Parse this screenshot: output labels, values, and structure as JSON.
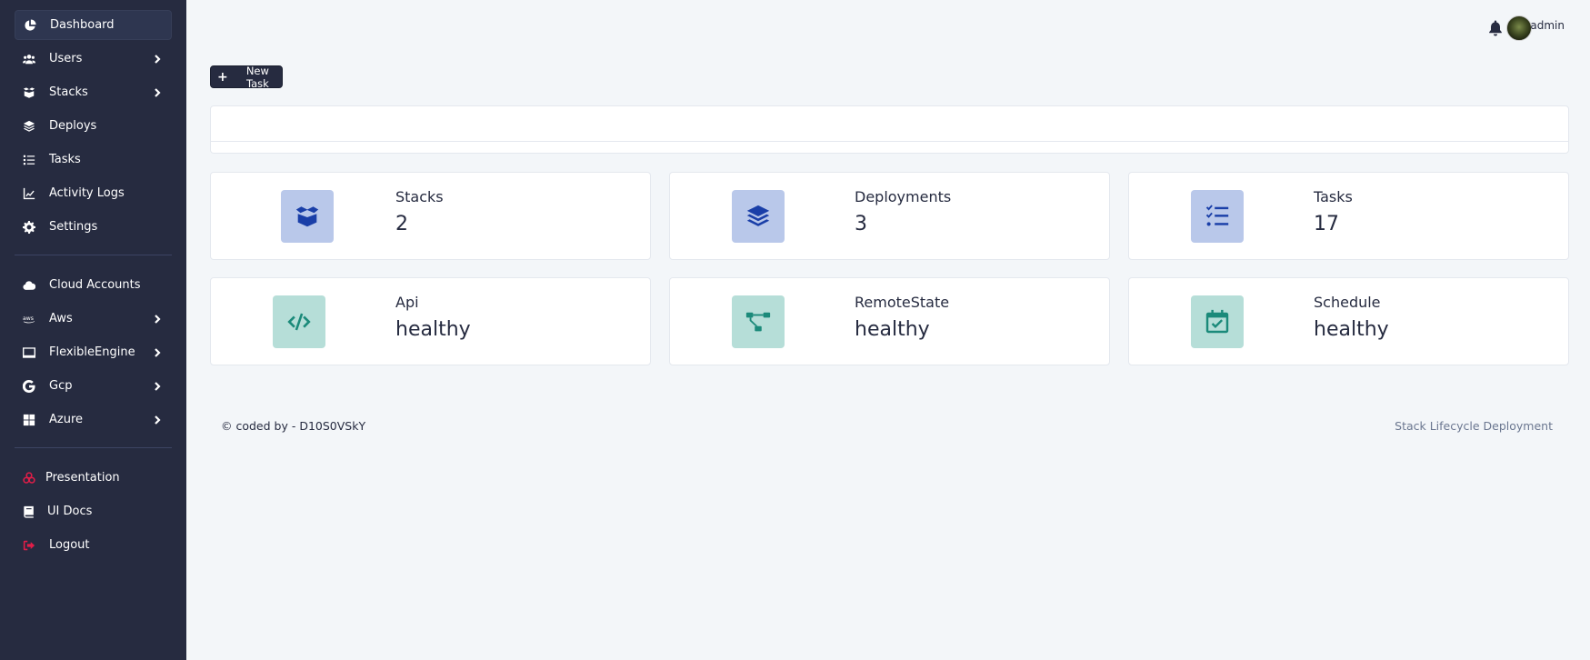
{
  "sidebar": {
    "primary": [
      {
        "label": "Dashboard",
        "icon": "chart-pie-icon",
        "active": true,
        "expandable": false
      },
      {
        "label": "Users",
        "icon": "users-icon",
        "active": false,
        "expandable": true
      },
      {
        "label": "Stacks",
        "icon": "box-open-icon",
        "active": false,
        "expandable": true
      },
      {
        "label": "Deploys",
        "icon": "layer-group-icon",
        "active": false,
        "expandable": false
      },
      {
        "label": "Tasks",
        "icon": "tasks-icon",
        "active": false,
        "expandable": false
      },
      {
        "label": "Activity Logs",
        "icon": "chart-line-icon",
        "active": false,
        "expandable": false
      },
      {
        "label": "Settings",
        "icon": "gear-icon",
        "active": false,
        "expandable": false
      }
    ],
    "cloud": [
      {
        "label": "Cloud Accounts",
        "icon": "cloud-icon",
        "expandable": false
      },
      {
        "label": "Aws",
        "icon": "aws-icon",
        "expandable": true
      },
      {
        "label": "FlexibleEngine",
        "icon": "laptop-icon",
        "expandable": true
      },
      {
        "label": "Gcp",
        "icon": "google-icon",
        "expandable": true
      },
      {
        "label": "Azure",
        "icon": "windows-icon",
        "expandable": true
      }
    ],
    "bottom": [
      {
        "label": "Presentation",
        "icon": "presentation-icon",
        "icon_color": "#e11d48"
      },
      {
        "label": "UI Docs",
        "icon": "book-icon",
        "icon_color": "#ffffff"
      },
      {
        "label": "Logout",
        "icon": "sign-out-icon",
        "icon_color": "#e11d48"
      }
    ]
  },
  "topbar": {
    "username": "admin"
  },
  "actions": {
    "new_task_label": "New Task"
  },
  "stats": [
    {
      "title": "Stacks",
      "value": "2",
      "icon": "box-open-icon",
      "tone": "blue"
    },
    {
      "title": "Deployments",
      "value": "3",
      "icon": "layer-group-icon",
      "tone": "blue"
    },
    {
      "title": "Tasks",
      "value": "17",
      "icon": "tasks-icon",
      "tone": "blue"
    },
    {
      "title": "Api",
      "value": "healthy",
      "icon": "code-icon",
      "tone": "teal"
    },
    {
      "title": "RemoteState",
      "value": "healthy",
      "icon": "project-diagram-icon",
      "tone": "teal"
    },
    {
      "title": "Schedule",
      "value": "healthy",
      "icon": "calendar-check-icon",
      "tone": "teal"
    }
  ],
  "footer": {
    "left": "© coded by - D10S0VSkY",
    "right": "Stack Lifecycle Deployment"
  },
  "colors": {
    "sidebar_bg": "#262b40",
    "page_bg": "#f3f6f9",
    "blue_icon_bg": "#b9c8ea",
    "blue_icon": "#1a3fa8",
    "teal_icon_bg": "#b6ded8",
    "teal_icon": "#1b8a7a",
    "danger": "#e11d48"
  }
}
